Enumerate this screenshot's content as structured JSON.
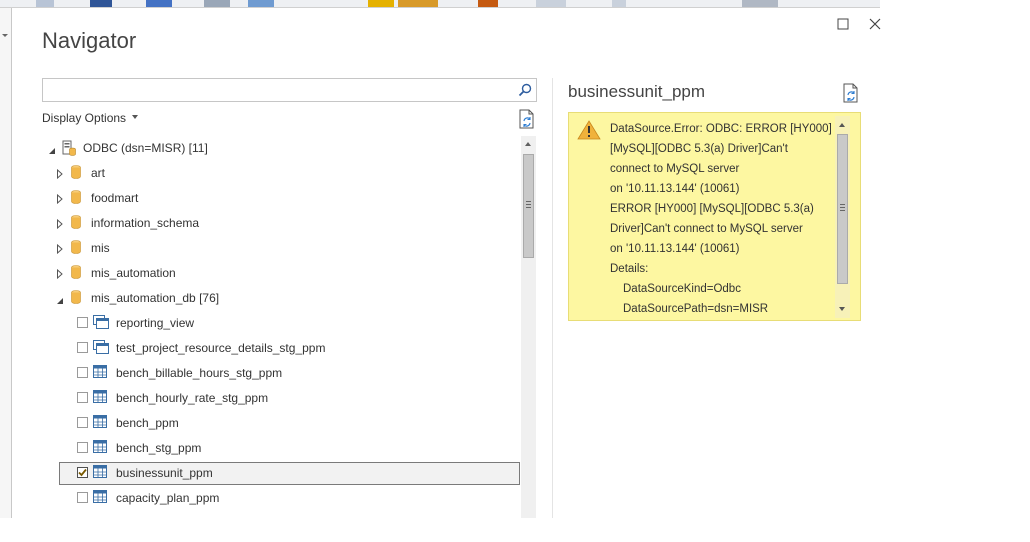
{
  "dialog": {
    "title": "Navigator"
  },
  "search": {
    "value": "",
    "placeholder": ""
  },
  "display_options": {
    "label": "Display Options"
  },
  "tree": {
    "root": {
      "label": "ODBC (dsn=MISR) [11]",
      "expanded": true
    },
    "databases": [
      {
        "label": "art",
        "expanded": false
      },
      {
        "label": "foodmart",
        "expanded": false
      },
      {
        "label": "information_schema",
        "expanded": false
      },
      {
        "label": "mis",
        "expanded": false
      },
      {
        "label": "mis_automation",
        "expanded": false
      },
      {
        "label": "mis_automation_db [76]",
        "expanded": true
      }
    ],
    "items": [
      {
        "label": "reporting_view",
        "type": "view",
        "checked": false
      },
      {
        "label": "test_project_resource_details_stg_ppm",
        "type": "view",
        "checked": false
      },
      {
        "label": "bench_billable_hours_stg_ppm",
        "type": "table",
        "checked": false
      },
      {
        "label": "bench_hourly_rate_stg_ppm",
        "type": "table",
        "checked": false
      },
      {
        "label": "bench_ppm",
        "type": "table",
        "checked": false
      },
      {
        "label": "bench_stg_ppm",
        "type": "table",
        "checked": false
      },
      {
        "label": "businessunit_ppm",
        "type": "table",
        "checked": true
      },
      {
        "label": "capacity_plan_ppm",
        "type": "table",
        "checked": false
      }
    ]
  },
  "preview": {
    "title": "businessunit_ppm",
    "error_lines": [
      "DataSource.Error: ODBC: ERROR [HY000]",
      "[MySQL][ODBC 5.3(a) Driver]Can't",
      "connect to MySQL server",
      "on '10.11.13.144' (10061)",
      "ERROR [HY000] [MySQL][ODBC 5.3(a)",
      "Driver]Can't connect to MySQL server",
      "on '10.11.13.144' (10061)",
      "Details:"
    ],
    "details": [
      "DataSourceKind=Odbc",
      "DataSourcePath=dsn=MISR"
    ]
  },
  "colors": {
    "error_background": "#fdf7a1",
    "db_icon": "#f2b84b",
    "table_icon": "#3a6ea5",
    "checkmark": "#7a5a00"
  },
  "icons": {
    "window": [
      "maximize-icon",
      "close-icon"
    ],
    "search": "search-icon",
    "refresh": "refresh-icon",
    "warning": "warning-icon",
    "database": "database-icon",
    "table": "table-icon",
    "view": "view-icon"
  }
}
